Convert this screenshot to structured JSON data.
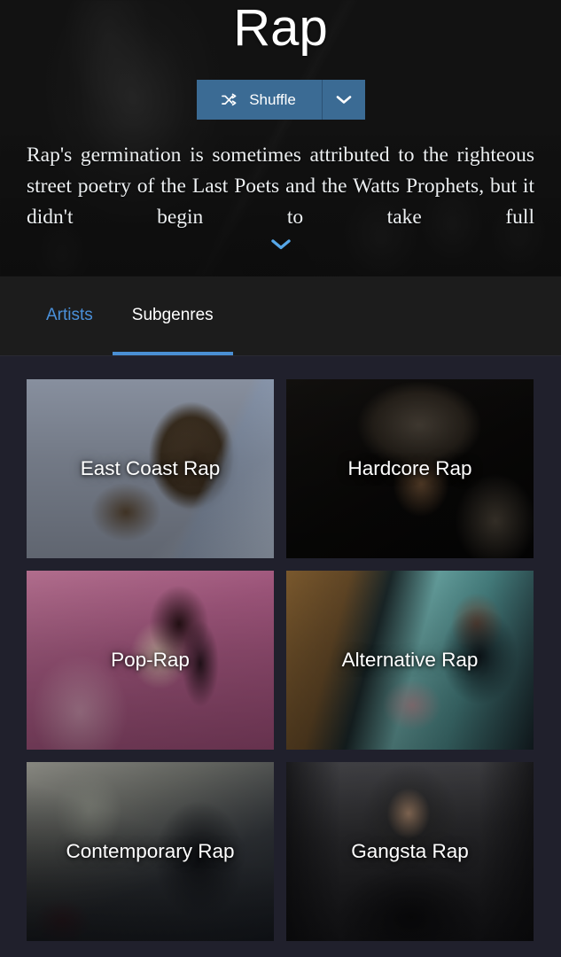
{
  "hero": {
    "title": "Rap",
    "shuffle_label": "Shuffle",
    "shuffle_icon": "shuffle-icon",
    "dropdown_icon": "chevron-down-icon",
    "description": "Rap's germination is sometimes attributed to the righteous street poetry of the Last Poets and the Watts Prophets, but it didn't begin to take full",
    "expand_icon": "chevron-down-icon",
    "accent_color": "#3b6b94"
  },
  "tabs": {
    "items": [
      {
        "label": "Artists",
        "active": false
      },
      {
        "label": "Subgenres",
        "active": true
      }
    ],
    "active_underline_color": "#4a8fd4",
    "inactive_color": "#4a90d9"
  },
  "grid": {
    "tiles": [
      {
        "label": "East Coast Rap"
      },
      {
        "label": "Hardcore Rap"
      },
      {
        "label": "Pop-Rap"
      },
      {
        "label": "Alternative Rap"
      },
      {
        "label": "Contemporary Rap"
      },
      {
        "label": "Gangsta Rap"
      }
    ]
  }
}
